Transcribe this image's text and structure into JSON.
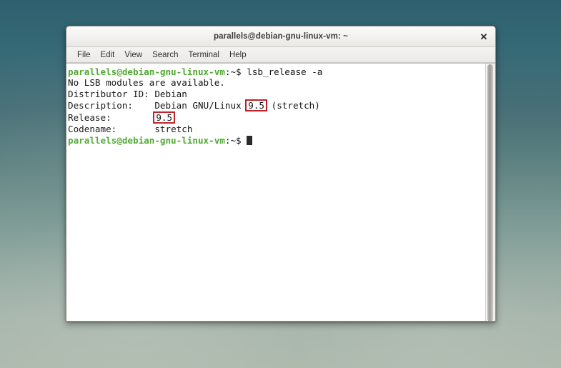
{
  "desktop": {
    "wallpaper_top_color": "#2e5f6e",
    "wallpaper_bottom_color": "#aebaae"
  },
  "window": {
    "title": "parallels@debian-gnu-linux-vm: ~",
    "close_icon": "✕",
    "close_label": "Close"
  },
  "menubar": {
    "items": [
      {
        "label": "File"
      },
      {
        "label": "Edit"
      },
      {
        "label": "View"
      },
      {
        "label": "Search"
      },
      {
        "label": "Terminal"
      },
      {
        "label": "Help"
      }
    ]
  },
  "terminal": {
    "highlight_color": "#bf2027",
    "prompt_color": "#4fa832",
    "background_color": "#ffffff",
    "foreground_color": "#131313",
    "prompt_user_host": "parallels@debian-gnu-linux-vm",
    "prompt_suffix": ":~$",
    "command": "lsb_release -a",
    "lines": {
      "no_modules": "No LSB modules are available.",
      "distributor_label": "Distributor ID:",
      "distributor_value": "Debian",
      "description_label": "Description:",
      "description_prefix": "Debian GNU/Linux",
      "description_version": "9.5",
      "description_suffix": "(stretch)",
      "release_label": "Release:",
      "release_value": "9.5",
      "codename_label": "Codename:",
      "codename_value": "stretch"
    },
    "cursor": "block"
  }
}
